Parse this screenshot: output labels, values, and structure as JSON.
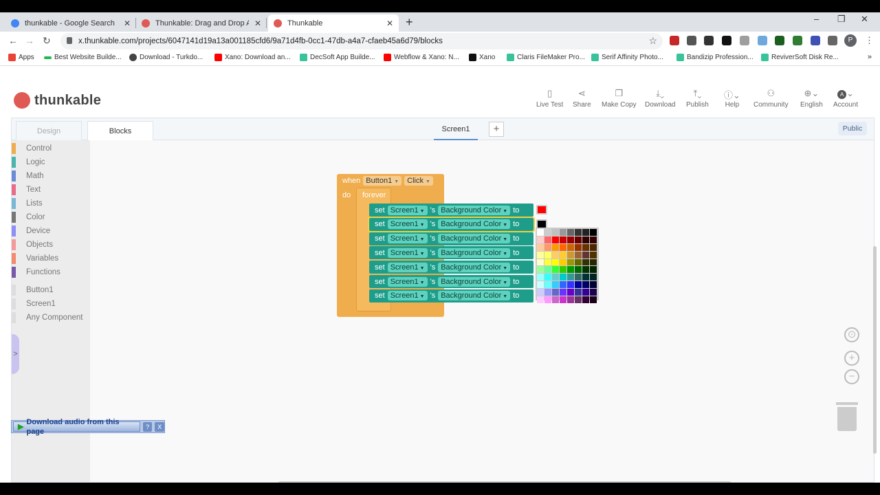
{
  "browser": {
    "tabs": [
      {
        "label": "thunkable - Google Search",
        "favicon": "google-icon",
        "active": false
      },
      {
        "label": "Thunkable: Drag and Drop App B",
        "favicon": "thunkable-icon",
        "active": false
      },
      {
        "label": "Thunkable",
        "favicon": "thunkable-icon",
        "active": true
      }
    ],
    "new_tab": "+",
    "url": "x.thunkable.com/projects/6047141d19a13a001185cfd6/9a71d4fb-0cc1-47db-a4a7-cfaeb45a6d79/blocks",
    "profile_initial": "P",
    "bookmarks": [
      {
        "label": "Apps",
        "color": "#ea4335"
      },
      {
        "label": "Best Website Builde...",
        "color": "#1db954"
      },
      {
        "label": "Download - Turkdo...",
        "color": "#444444"
      },
      {
        "label": "Xano: Download an...",
        "color": "#ff0000"
      },
      {
        "label": "DecSoft App Builde...",
        "color": "#38c39b"
      },
      {
        "label": "Webflow & Xano: N...",
        "color": "#ff0000"
      },
      {
        "label": "Xano",
        "color": "#111111"
      },
      {
        "label": "Claris FileMaker Pro...",
        "color": "#38c39b"
      },
      {
        "label": "Serif Affinity Photo...",
        "color": "#38c39b"
      },
      {
        "label": "Bandizip Profession...",
        "color": "#38c39b"
      },
      {
        "label": "ReviverSoft Disk Re...",
        "color": "#38c39b"
      }
    ],
    "bookmarks_more": "»"
  },
  "app": {
    "logo_text": "thunkable",
    "nav": [
      {
        "label": "Live Test",
        "icon": "phone-icon"
      },
      {
        "label": "Share",
        "icon": "share-icon"
      },
      {
        "label": "Make Copy",
        "icon": "copy-icon"
      },
      {
        "label": "Download",
        "icon": "download-icon"
      },
      {
        "label": "Publish",
        "icon": "publish-icon"
      },
      {
        "label": "Help",
        "icon": "help-icon"
      },
      {
        "label": "Community",
        "icon": "community-icon"
      },
      {
        "label": "English",
        "icon": "globe-icon"
      },
      {
        "label": "Account",
        "icon": "account-icon",
        "initial": "A"
      }
    ],
    "editor_tabs": {
      "design": "Design",
      "blocks": "Blocks"
    },
    "screen_tab": "Screen1",
    "add_screen": "+",
    "public_badge": "Public",
    "palette": {
      "categories": [
        {
          "label": "Control",
          "color": "#f0ad4e"
        },
        {
          "label": "Logic",
          "color": "#4db6ac"
        },
        {
          "label": "Math",
          "color": "#6b8dd6"
        },
        {
          "label": "Text",
          "color": "#e86c8a"
        },
        {
          "label": "Lists",
          "color": "#7ab8d6"
        },
        {
          "label": "Color",
          "color": "#777777"
        },
        {
          "label": "Device",
          "color": "#8f8ff5"
        },
        {
          "label": "Objects",
          "color": "#f49a9a"
        },
        {
          "label": "Variables",
          "color": "#f48a6e"
        },
        {
          "label": "Functions",
          "color": "#7a5aa8"
        }
      ],
      "components": [
        "Button1",
        "Screen1",
        "Any Component"
      ]
    },
    "blocks": {
      "event": {
        "when": "when",
        "component": "Button1",
        "event": "Click",
        "do": "do"
      },
      "loop": "forever",
      "set_rows": [
        {
          "set": "set",
          "target": "Screen1",
          "poss": "'s",
          "prop": "Background Color",
          "to": "to",
          "swatch": "#ff0000"
        },
        {
          "set": "set",
          "target": "Screen1",
          "poss": "'s",
          "prop": "Background Color",
          "to": "to",
          "swatch": "#000000"
        },
        {
          "set": "set",
          "target": "Screen1",
          "poss": "'s",
          "prop": "Background Color",
          "to": "to"
        },
        {
          "set": "set",
          "target": "Screen1",
          "poss": "'s",
          "prop": "Background Color",
          "to": "to"
        },
        {
          "set": "set",
          "target": "Screen1",
          "poss": "'s",
          "prop": "Background Color",
          "to": "to"
        },
        {
          "set": "set",
          "target": "Screen1",
          "poss": "'s",
          "prop": "Background Color",
          "to": "to"
        },
        {
          "set": "set",
          "target": "Screen1",
          "poss": "'s",
          "prop": "Background Color",
          "to": "to"
        }
      ]
    },
    "color_picker": [
      "#ffffff",
      "#cccccc",
      "#c0c0c0",
      "#999999",
      "#666666",
      "#333333",
      "#222222",
      "#000000",
      "#ffcccc",
      "#ff6666",
      "#ff0000",
      "#cc0000",
      "#990000",
      "#660000",
      "#330000",
      "#330000",
      "#ffcc99",
      "#ff9966",
      "#ff9900",
      "#ff6600",
      "#cc6600",
      "#993300",
      "#663300",
      "#4d2600",
      "#ffff99",
      "#ffff66",
      "#ffcc66",
      "#ffcc33",
      "#cc9933",
      "#996633",
      "#663333",
      "#4d3300",
      "#ffffcc",
      "#ffff33",
      "#ffff00",
      "#ffcc00",
      "#999900",
      "#666600",
      "#333300",
      "#262600",
      "#99ff99",
      "#66ff99",
      "#33ff33",
      "#33cc00",
      "#009900",
      "#006600",
      "#003300",
      "#002200",
      "#99ffff",
      "#33ffff",
      "#66cccc",
      "#00cccc",
      "#339999",
      "#336666",
      "#003333",
      "#002222",
      "#ccffff",
      "#66ffff",
      "#33ccff",
      "#3366ff",
      "#3333ff",
      "#000099",
      "#000066",
      "#000033",
      "#ccccff",
      "#9999ff",
      "#6666cc",
      "#6633ff",
      "#6600cc",
      "#333399",
      "#330099",
      "#1a004d",
      "#ffccff",
      "#ff99ff",
      "#cc66cc",
      "#cc33cc",
      "#993399",
      "#663366",
      "#330033",
      "#1a001a"
    ],
    "workspace_controls": {
      "center": "⊙",
      "zoom_in": "+",
      "zoom_out": "−"
    },
    "download_bar": {
      "label": "Download audio from this page",
      "help": "?",
      "close": "X"
    }
  }
}
